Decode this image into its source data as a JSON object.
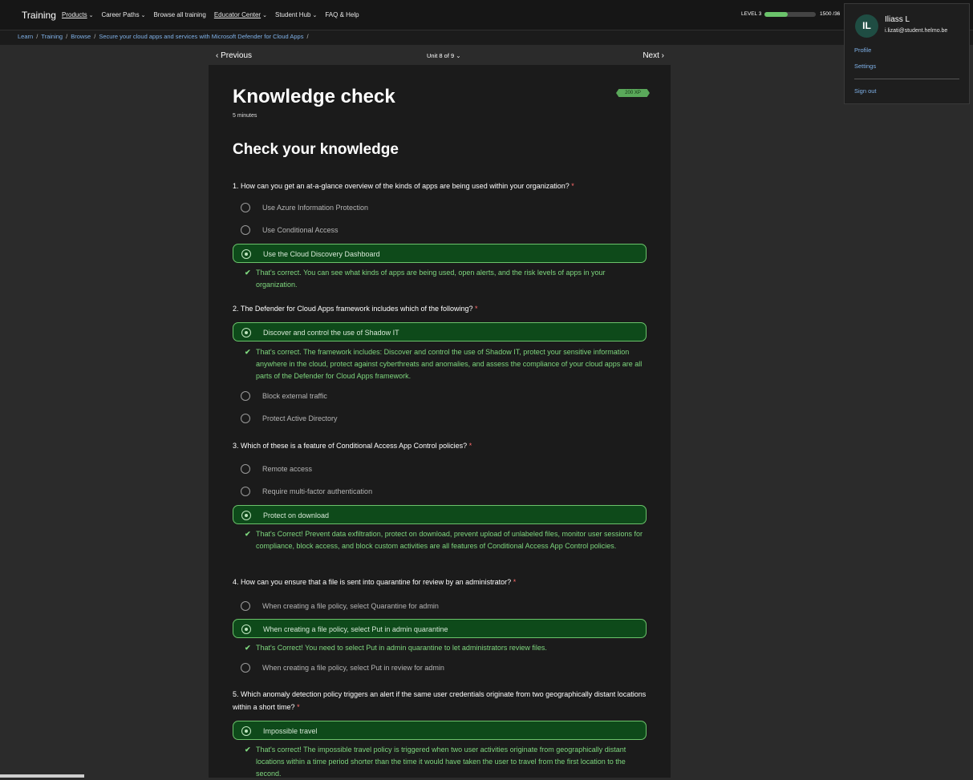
{
  "header": {
    "brand": "Training",
    "nav": [
      {
        "label": "Products",
        "dropdown": true,
        "underline": true
      },
      {
        "label": "Career Paths",
        "dropdown": true
      },
      {
        "label": "Browse all training",
        "dropdown": false
      },
      {
        "label": "Educator Center",
        "dropdown": true,
        "underline": true
      },
      {
        "label": "Student Hub",
        "dropdown": true
      },
      {
        "label": "FAQ & Help",
        "dropdown": false
      }
    ],
    "level": "LEVEL 3",
    "level_progress": 0.45,
    "xp": "1500 /36"
  },
  "breadcrumb": [
    "Learn",
    "Training",
    "Browse",
    "Secure your cloud apps and services with Microsoft Defender for Cloud Apps"
  ],
  "unit_nav": {
    "prev": "Previous",
    "unit": "Unit 8 of 9",
    "next": "Next"
  },
  "content": {
    "title": "Knowledge check",
    "duration": "5 minutes",
    "xp_badge": "200 XP",
    "heading": "Check your knowledge",
    "questions": [
      {
        "text": "1. How can you get an at-a-glance overview of the kinds of apps are being used within your organization?",
        "options": [
          "Use Azure Information Protection",
          "Use Conditional Access",
          "Use the Cloud Discovery Dashboard"
        ],
        "feedback": "That's correct. You can see what kinds of apps are being used, open alerts, and the risk levels of apps in your organization."
      },
      {
        "text": "2. The Defender for Cloud Apps framework includes which of the following?",
        "options": [
          "Discover and control the use of Shadow IT",
          "Block external traffic",
          "Protect Active Directory"
        ],
        "feedback": "That's correct. The framework includes: Discover and control the use of Shadow IT, protect your sensitive information anywhere in the cloud, protect against cyberthreats and anomalies, and assess the compliance of your cloud apps are all parts of the Defender for Cloud Apps framework."
      },
      {
        "text": "3. Which of these is a feature of Conditional Access App Control policies?",
        "options": [
          "Remote access",
          "Require multi-factor authentication",
          "Protect on download"
        ],
        "feedback": "That's Correct! Prevent data exfiltration, protect on download, prevent upload of unlabeled files, monitor user sessions for compliance, block access, and block custom activities are all features of Conditional Access App Control policies."
      },
      {
        "text": "4. How can you ensure that a file is sent into quarantine for review by an administrator?",
        "options": [
          "When creating a file policy, select Quarantine for admin",
          "When creating a file policy, select Put in admin quarantine",
          "When creating a file policy, select Put in review for admin"
        ],
        "feedback": "That's Correct! You need to select Put in admin quarantine to let administrators review files."
      },
      {
        "text": "5. Which anomaly detection policy triggers an alert if the same user credentials originate from two geographically distant locations within a short time?",
        "options": [
          "Impossible travel"
        ],
        "feedback": "That's correct! The impossible travel policy is triggered when two user activities originate from geographically distant locations within a time period shorter than the time it would have taken the user to travel from the first location to the second."
      }
    ]
  },
  "user_menu": {
    "initials": "IL",
    "name": "Iliass L",
    "email": "i.lizati@student.helmo.be",
    "links": [
      "Profile",
      "Settings",
      "Sign out"
    ]
  }
}
